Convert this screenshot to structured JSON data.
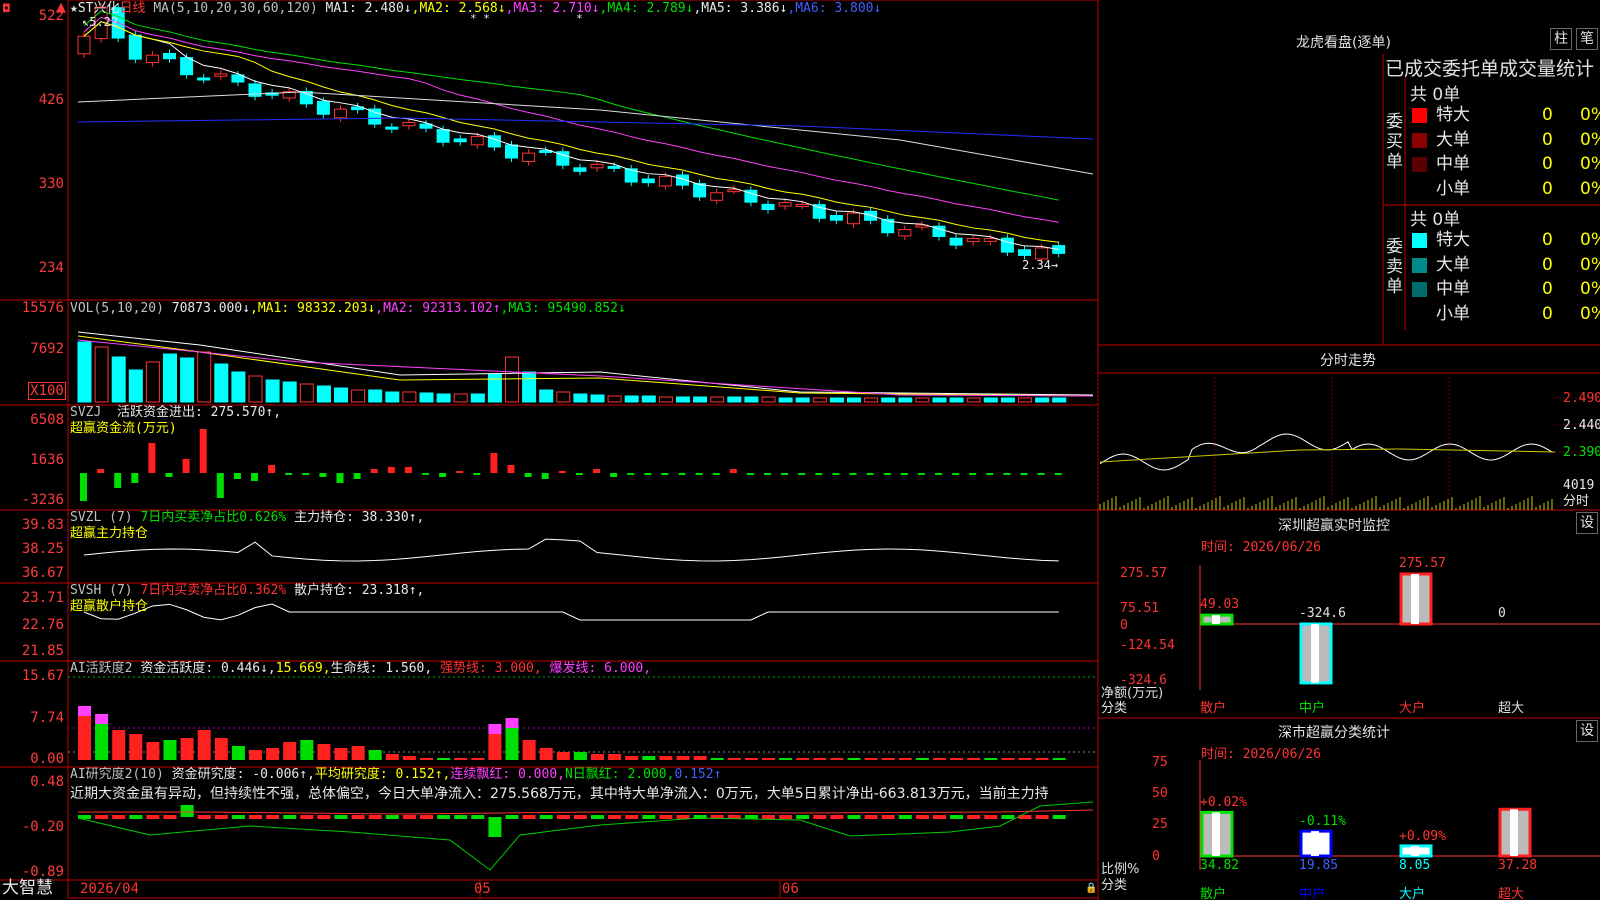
{
  "stock": {
    "name": "ST兴化",
    "period": "日线",
    "high_mark": "5.22",
    "low_mark": "2.34"
  },
  "price_axis": [
    "522",
    "426",
    "330",
    "234"
  ],
  "ma_line": {
    "label": "MA(5,10,20,30,60,120)",
    "items": [
      {
        "name": "MA1",
        "value": "2.480↓"
      },
      {
        "name": "MA2",
        "value": "2.568↓"
      },
      {
        "name": "MA3",
        "value": "2.710↓"
      },
      {
        "name": "MA4",
        "value": "2.789↓"
      },
      {
        "name": "MA5",
        "value": "3.386↓"
      },
      {
        "name": "MA6",
        "value": "3.800↓"
      }
    ]
  },
  "vol_axis": [
    "15576",
    "7692",
    "X100"
  ],
  "vol_line": {
    "label": "VOL(5,10,20)",
    "value": "70873.000↓",
    "items": [
      {
        "name": "MA1",
        "value": "98332.203↓"
      },
      {
        "name": "MA2",
        "value": "92313.102↑"
      },
      {
        "name": "MA3",
        "value": "95490.852↓"
      }
    ]
  },
  "svzj": {
    "axis": [
      "6508",
      "1636",
      "-3236"
    ],
    "label": "SVZJ",
    "desc": "活跃资金进出: 275.570↑,",
    "sub": "超赢资金流(万元)"
  },
  "svzl": {
    "axis": [
      "39.83",
      "38.25",
      "36.67"
    ],
    "label": "SVZL (7)",
    "ratio": "7日内买卖净占比0.626%",
    "hold": "主力持仓: 38.330↑,",
    "sub": "超赢主力持仓"
  },
  "svsh": {
    "axis": [
      "23.71",
      "22.76",
      "21.85"
    ],
    "label": "SVSH (7)",
    "ratio": "7日内买卖净占比0.362%",
    "hold": "散户持仓: 23.318↑,",
    "sub": "超赢散户持仓"
  },
  "ai_active": {
    "axis": [
      "15.67",
      "7.74",
      "0.00"
    ],
    "label": "AI活跃度2",
    "a": "资金活跃度: 0.446↓,",
    "b": "15.669,",
    "c": "生命线: 1.560,",
    "d": "强势线: 3.000,",
    "e": "爆发线: 6.000,"
  },
  "ai_research": {
    "axis": [
      "0.48",
      "-0.20",
      "-0.89"
    ],
    "label": "AI研究度2(10)",
    "a": "资金研究度: -0.006↑,",
    "b": "平均研究度: 0.152↑,",
    "c": "连续飘红: 0.000,",
    "d": "N日飘红: 2.000,",
    "e": "0.152↑",
    "note": "近期大资金虽有异动，但持续性不强，总体偏空，今日大单净流入：275.568万元，其中特大单净流入：0万元，大单5日累计净出-663.813万元，当前主力持"
  },
  "bottom": {
    "brand": "大智慧",
    "dates": [
      "2026/04",
      "05",
      "06"
    ]
  },
  "dragon": {
    "title": "龙虎看盘(逐单)",
    "btn1": "柱",
    "btn2": "笔",
    "header": "已成交委托单成交量统计",
    "buy": {
      "side": "委买单",
      "total": "共 0单",
      "rows": [
        {
          "label": "特大",
          "num": "0",
          "pct": "0%",
          "color": "#ff0000"
        },
        {
          "label": "大单",
          "num": "0",
          "pct": "0%",
          "color": "#8b0000"
        },
        {
          "label": "中单",
          "num": "0",
          "pct": "0%",
          "color": "#5a0000"
        },
        {
          "label": "小单",
          "num": "0",
          "pct": "0%",
          "color": "#000000"
        }
      ]
    },
    "sell": {
      "side": "委卖单",
      "total": "共 0单",
      "rows": [
        {
          "label": "特大",
          "num": "0",
          "pct": "0%",
          "color": "#00ffff"
        },
        {
          "label": "大单",
          "num": "0",
          "pct": "0%",
          "color": "#008b8b"
        },
        {
          "label": "中单",
          "num": "0",
          "pct": "0%",
          "color": "#006b6b"
        },
        {
          "label": "小单",
          "num": "0",
          "pct": "0%",
          "color": "#000000"
        }
      ]
    }
  },
  "intraday": {
    "title": "分时走势",
    "axis": [
      "2.490",
      "2.440",
      "2.390",
      "4019",
      "分时"
    ]
  },
  "monitor": {
    "title": "深圳超赢实时监控",
    "btn": "设",
    "time": "时间: 2026/06/26",
    "axis": [
      "275.57",
      "75.51",
      "0",
      "-124.54",
      "-324.6"
    ],
    "ylabel": "净额(万元)",
    "xlabel": "分类",
    "cats": [
      "散户",
      "中户",
      "大户",
      "超大"
    ],
    "values": [
      "49.03",
      "-324.6",
      "275.57",
      "0"
    ]
  },
  "classify": {
    "title": "深市超赢分类统计",
    "btn": "设",
    "time": "时间: 2026/06/26",
    "axis": [
      "75",
      "50",
      "25",
      "0"
    ],
    "ylabel": "比例%",
    "xlabel": "分类",
    "cats": [
      "散户",
      "中户",
      "大户",
      "超大"
    ],
    "values": [
      "34.82",
      "19.85",
      "8.05",
      "37.28"
    ],
    "changes": [
      "+0.02%",
      "-0.11%",
      "+0.09%",
      ""
    ]
  }
}
